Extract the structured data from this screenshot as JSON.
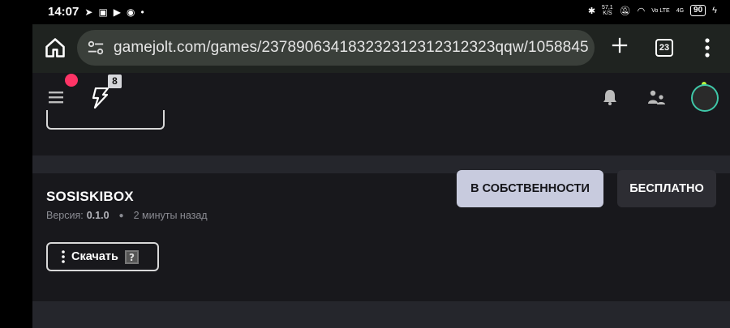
{
  "status_bar": {
    "time": "14:07",
    "network_speed": "57,1",
    "network_speed_unit": "K/S",
    "carrier": "Vo LTE",
    "signal": "4G",
    "battery": "90"
  },
  "browser": {
    "url": "gamejolt.com/games/237890634183232312312312323qqw/1058845",
    "tab_count": "23"
  },
  "site_header": {
    "notification_badge": "8"
  },
  "game_build": {
    "title": "SOSISKIBOX",
    "version_label": "Версия:",
    "version": "0.1.0",
    "time_ago": "2 минуты назад",
    "owned_button": "В СОБСТВЕННОСТИ",
    "free_button": "БЕСПЛАТНО",
    "download_button": "Скачать"
  },
  "colors": {
    "accent_red": "#ff3466",
    "owned_button_bg": "#c8cbde",
    "card_bg": "#18181c"
  }
}
